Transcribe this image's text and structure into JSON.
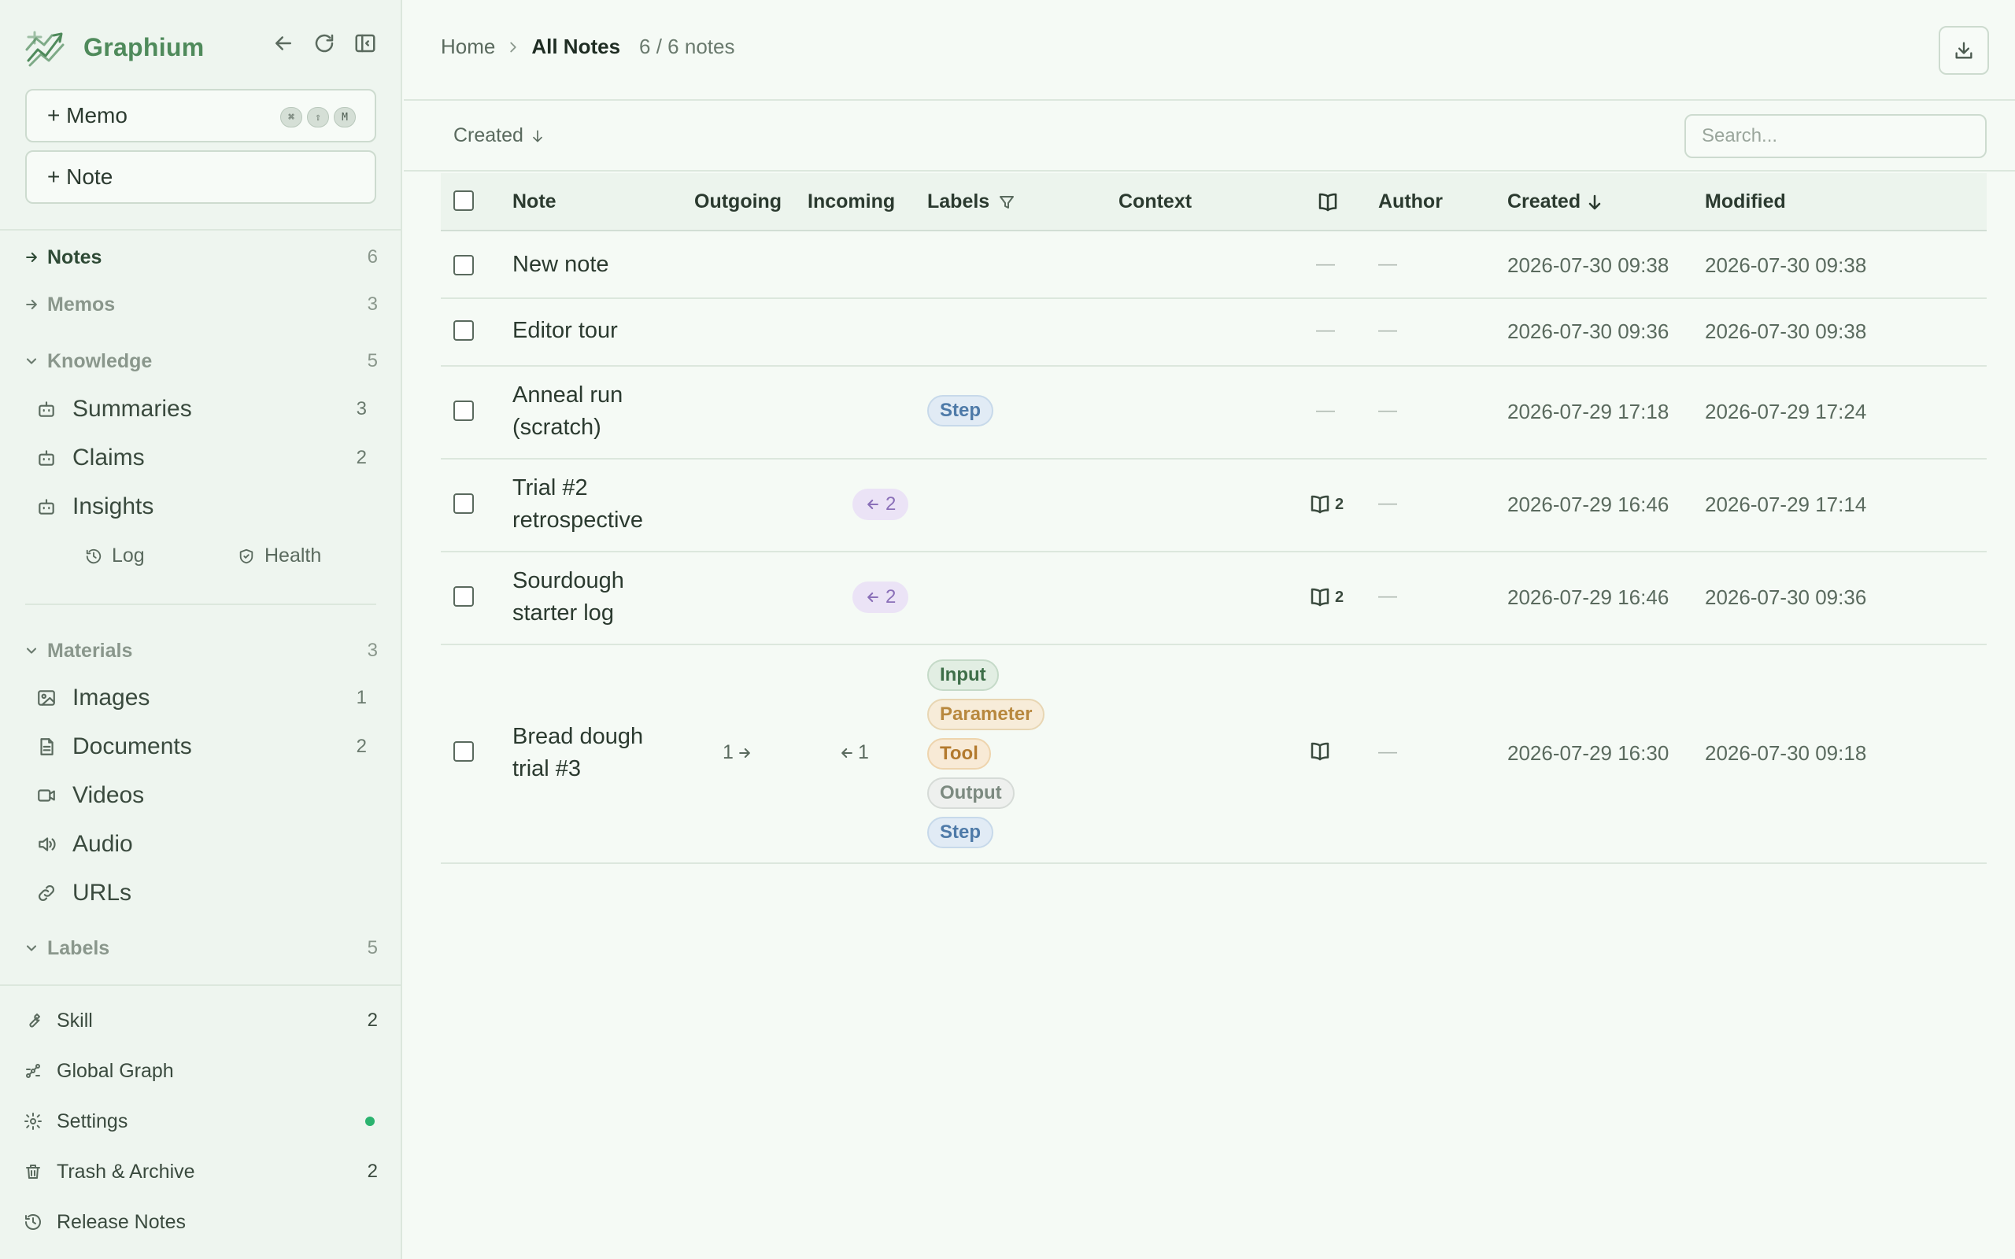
{
  "app": {
    "name": "Graphium"
  },
  "sidebar": {
    "memo_button": "+ Memo",
    "memo_shortcut": [
      "⌘",
      "⇧",
      "M"
    ],
    "note_button": "+ Note",
    "notes": {
      "label": "Notes",
      "count": "6"
    },
    "memos": {
      "label": "Memos",
      "count": "3"
    },
    "knowledge": {
      "label": "Knowledge",
      "count": "5",
      "items": [
        {
          "label": "Summaries",
          "count": "3",
          "icon": "robot-icon"
        },
        {
          "label": "Claims",
          "count": "2",
          "icon": "robot-icon"
        },
        {
          "label": "Insights",
          "count": "",
          "icon": "robot-icon"
        }
      ],
      "log": "Log",
      "health": "Health"
    },
    "materials": {
      "label": "Materials",
      "count": "3",
      "items": [
        {
          "label": "Images",
          "count": "1",
          "icon": "image-icon"
        },
        {
          "label": "Documents",
          "count": "2",
          "icon": "document-icon"
        },
        {
          "label": "Videos",
          "count": "",
          "icon": "video-icon"
        },
        {
          "label": "Audio",
          "count": "",
          "icon": "speaker-icon"
        },
        {
          "label": "URLs",
          "count": "",
          "icon": "link-icon"
        }
      ]
    },
    "labels": {
      "label": "Labels",
      "count": "5"
    },
    "bottom": {
      "skill": {
        "label": "Skill",
        "count": "2"
      },
      "global_graph": {
        "label": "Global Graph"
      },
      "settings": {
        "label": "Settings",
        "status_color": "#2bb36f"
      },
      "trash": {
        "label": "Trash & Archive",
        "count": "2"
      },
      "release_notes": {
        "label": "Release Notes"
      }
    }
  },
  "header": {
    "breadcrumb_home": "Home",
    "breadcrumb_current": "All Notes",
    "note_count": "6 / 6 notes"
  },
  "toolbar": {
    "sort_label": "Created",
    "search_placeholder": "Search..."
  },
  "table": {
    "columns": {
      "note": "Note",
      "outgoing": "Outgoing",
      "incoming": "Incoming",
      "labels": "Labels",
      "context": "Context",
      "author": "Author",
      "created": "Created",
      "modified": "Modified"
    },
    "rows": [
      {
        "title": "New note",
        "outgoing": "",
        "incoming": "",
        "labels": [],
        "sources": "—",
        "author": "—",
        "created": "2026-07-30 09:38",
        "modified": "2026-07-30 09:38"
      },
      {
        "title": "Editor tour",
        "outgoing": "",
        "incoming": "",
        "labels": [],
        "sources": "—",
        "author": "—",
        "created": "2026-07-30 09:36",
        "modified": "2026-07-30 09:38"
      },
      {
        "title": "Anneal run (scratch)",
        "outgoing": "",
        "incoming": "",
        "labels": [
          "Step"
        ],
        "sources": "—",
        "author": "—",
        "created": "2026-07-29 17:18",
        "modified": "2026-07-29 17:24"
      },
      {
        "title": "Trial #2 retrospective",
        "outgoing": "",
        "incoming": "2",
        "labels": [],
        "sources": "2",
        "author": "—",
        "created": "2026-07-29 16:46",
        "modified": "2026-07-29 17:14"
      },
      {
        "title": "Sourdough starter log",
        "outgoing": "",
        "incoming": "2",
        "labels": [],
        "sources": "2",
        "author": "—",
        "created": "2026-07-29 16:46",
        "modified": "2026-07-30 09:36"
      },
      {
        "title": "Bread dough trial #3",
        "outgoing": "1",
        "incoming": "1",
        "labels": [
          "Input",
          "Parameter",
          "Tool",
          "Output",
          "Step"
        ],
        "sources": "",
        "author": "—",
        "created": "2026-07-29 16:30",
        "modified": "2026-07-30 09:18"
      }
    ]
  }
}
